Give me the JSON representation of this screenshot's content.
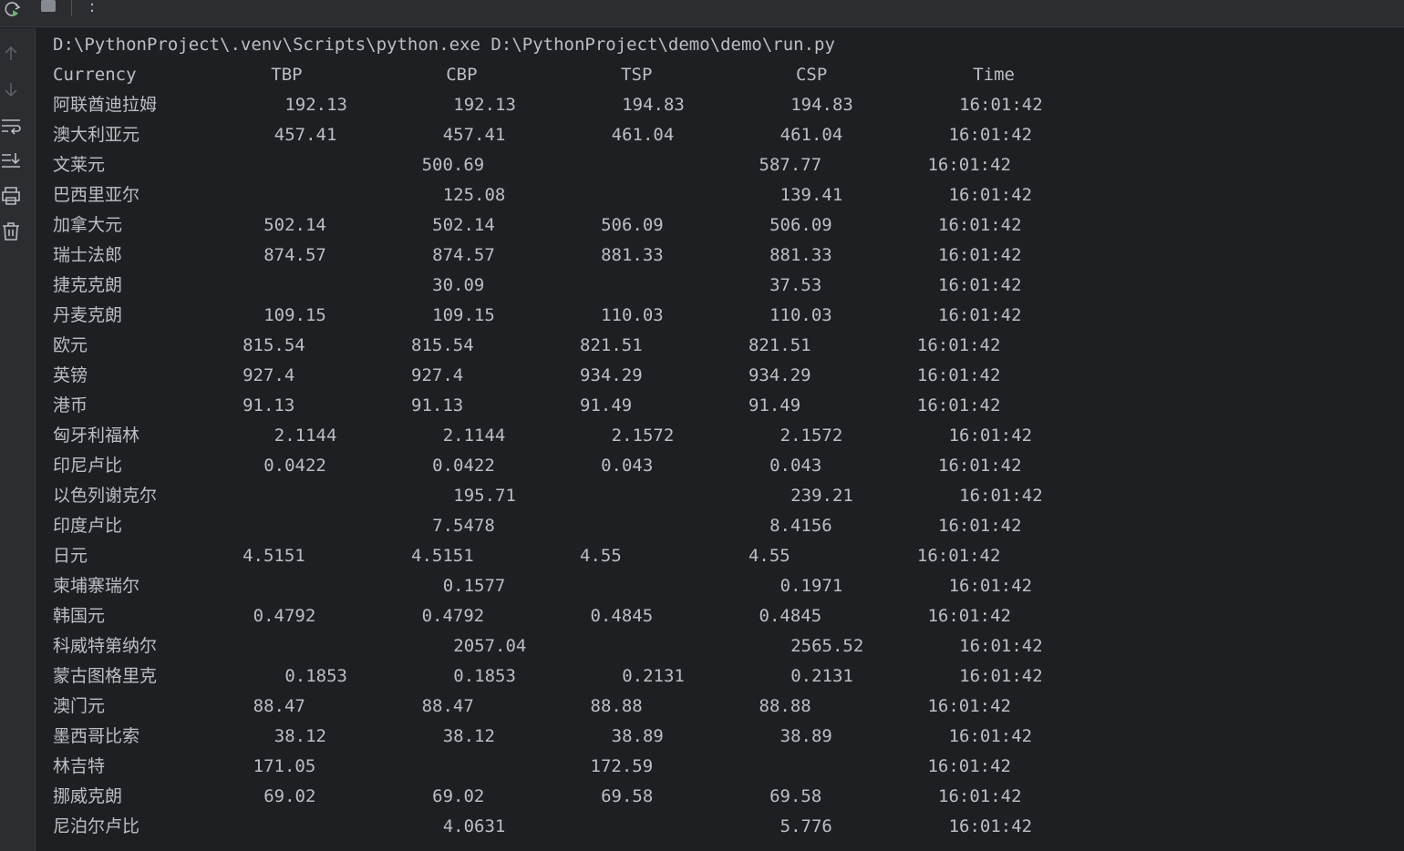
{
  "toolbar": {
    "rerun_icon": "rerun-icon",
    "stop_icon": "stop-icon",
    "more_label": ":"
  },
  "sidebar": {
    "icons": [
      "arrow-up-icon",
      "arrow-down-icon",
      "soft-wrap-icon",
      "scroll-to-end-icon",
      "print-icon",
      "trash-icon"
    ]
  },
  "console": {
    "command": "D:\\PythonProject\\.venv\\Scripts\\python.exe D:\\PythonProject\\demo\\demo\\run.py",
    "header": [
      "Currency",
      "TBP",
      "CBP",
      "TSP",
      "CSP",
      "Time"
    ],
    "rows": [
      [
        "阿联酋迪拉姆",
        "192.13",
        "192.13",
        "194.83",
        "194.83",
        "16:01:42"
      ],
      [
        "澳大利亚元",
        "457.41",
        "457.41",
        "461.04",
        "461.04",
        "16:01:42"
      ],
      [
        "文莱元",
        "",
        "500.69",
        "",
        "587.77",
        "16:01:42"
      ],
      [
        "巴西里亚尔",
        "",
        "125.08",
        "",
        "139.41",
        "16:01:42"
      ],
      [
        "加拿大元",
        "502.14",
        "502.14",
        "506.09",
        "506.09",
        "16:01:42"
      ],
      [
        "瑞士法郎",
        "874.57",
        "874.57",
        "881.33",
        "881.33",
        "16:01:42"
      ],
      [
        "捷克克朗",
        "",
        "30.09",
        "",
        "37.53",
        "16:01:42"
      ],
      [
        "丹麦克朗",
        "109.15",
        "109.15",
        "110.03",
        "110.03",
        "16:01:42"
      ],
      [
        "欧元",
        "815.54",
        "815.54",
        "821.51",
        "821.51",
        "16:01:42"
      ],
      [
        "英镑",
        "927.4",
        "927.4",
        "934.29",
        "934.29",
        "16:01:42"
      ],
      [
        "港币",
        "91.13",
        "91.13",
        "91.49",
        "91.49",
        "16:01:42"
      ],
      [
        "匈牙利福林",
        "2.1144",
        "2.1144",
        "2.1572",
        "2.1572",
        "16:01:42"
      ],
      [
        "印尼卢比",
        "0.0422",
        "0.0422",
        "0.043",
        "0.043",
        "16:01:42"
      ],
      [
        "以色列谢克尔",
        "",
        "195.71",
        "",
        "239.21",
        "16:01:42"
      ],
      [
        "印度卢比",
        "",
        "7.5478",
        "",
        "8.4156",
        "16:01:42"
      ],
      [
        "日元",
        "4.5151",
        "4.5151",
        "4.55",
        "4.55",
        "16:01:42"
      ],
      [
        "柬埔寨瑞尔",
        "",
        "0.1577",
        "",
        "0.1971",
        "16:01:42"
      ],
      [
        "韩国元",
        "0.4792",
        "0.4792",
        "0.4845",
        "0.4845",
        "16:01:42"
      ],
      [
        "科威特第纳尔",
        "",
        "2057.04",
        "",
        "2565.52",
        "16:01:42"
      ],
      [
        "蒙古图格里克",
        "0.1853",
        "0.1853",
        "0.2131",
        "0.2131",
        "16:01:42"
      ],
      [
        "澳门元",
        "88.47",
        "88.47",
        "88.88",
        "88.88",
        "16:01:42"
      ],
      [
        "墨西哥比索",
        "38.12",
        "38.12",
        "38.89",
        "38.89",
        "16:01:42"
      ],
      [
        "林吉特",
        "171.05",
        "",
        "172.59",
        "",
        "16:01:42"
      ],
      [
        "挪威克朗",
        "69.02",
        "69.02",
        "69.58",
        "69.58",
        "16:01:42"
      ],
      [
        "尼泊尔卢比",
        "",
        "4.0631",
        "",
        "5.776",
        "16:01:42"
      ]
    ]
  },
  "colors": {
    "background": "#1e1f22",
    "panel": "#2b2d30",
    "text": "#bcbec4",
    "run_green": "#5fb865"
  }
}
